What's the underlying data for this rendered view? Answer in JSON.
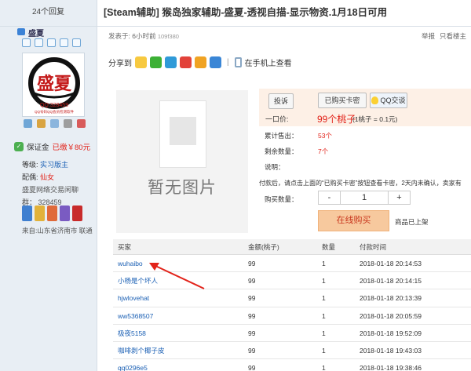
{
  "header": {
    "replies": "24个回复",
    "title": "[Steam辅助] 猴岛独家辅助-盛夏-透视自描-显示物资.1月18日可用"
  },
  "author": {
    "name": "盛夏",
    "avatar_text": "盛夏",
    "avatar_qq": "QQ:328459",
    "avatar_sub": "QQ号码QQ会员检测软件",
    "guarantee_label": "保证金",
    "guarantee_value": "已缴￥80元",
    "level_label": "等级:",
    "level_value": "实习版主",
    "title_label": "配偶:",
    "title_value": "仙女",
    "group": "盛夏网络交易闲聊",
    "qun": "群： 328459",
    "from": "来自:山东省济南市 联通"
  },
  "post": {
    "posted": "发表于: 6小时前",
    "post_id": "109f380",
    "report": "举报",
    "only_author": "只看楼主",
    "share_label": "分享到",
    "mobile_view": "在手机上查看"
  },
  "product": {
    "no_image": "暂无图片",
    "complain_btn": "投诉",
    "bought_btn": "已购买卡密",
    "qq_btn": "QQ交谈",
    "price_label": "一口价:",
    "price": "99个桃子",
    "price_note": "(1桃子 = 0.1元)",
    "sold_label": "累计售出：",
    "sold_value": "53个",
    "stock_label": "剩余数量：",
    "stock_value": "7个",
    "desc_label": "说明：",
    "notice": "付款后，请点击上面的“已购买卡密”按钮查看卡密，2天内未确认，卖家有",
    "qty_label": "购买数量：",
    "qty_minus": "-",
    "qty_value": "1",
    "qty_plus": "+",
    "buy_btn": "在线购买",
    "on_shelf": "商品已上架"
  },
  "table": {
    "headers": [
      "买家",
      "金额(桃子)",
      "数量",
      "付款时间"
    ],
    "rows": [
      [
        "wuhaibo",
        "99",
        "1",
        "2018-01-18 20:14:53"
      ],
      [
        "小杨是个坏人",
        "99",
        "1",
        "2018-01-18 20:14:15"
      ],
      [
        "hjwlovehat",
        "99",
        "1",
        "2018-01-18 20:13:39"
      ],
      [
        "ww5368507",
        "99",
        "1",
        "2018-01-18 20:05:59"
      ],
      [
        "极夜5158",
        "99",
        "1",
        "2018-01-18 19:52:09"
      ],
      [
        "咖啡剥个椰子皮",
        "99",
        "1",
        "2018-01-18 19:43:03"
      ],
      [
        "qq0296e5",
        "99",
        "1",
        "2018-01-18 19:38:46"
      ]
    ]
  },
  "colors": {
    "accent_red": "#e2231a",
    "link_blue": "#1a5fb4",
    "sidebar_bg": "#e8eef4",
    "price_bg": "#fdf0e6",
    "buy_btn_bg": "#f7c99e"
  },
  "icons": [
    "qq-icon",
    "wechat-icon",
    "qzone-icon",
    "weibo-icon",
    "star-icon",
    "tencent-weibo-icon",
    "phone-icon"
  ]
}
